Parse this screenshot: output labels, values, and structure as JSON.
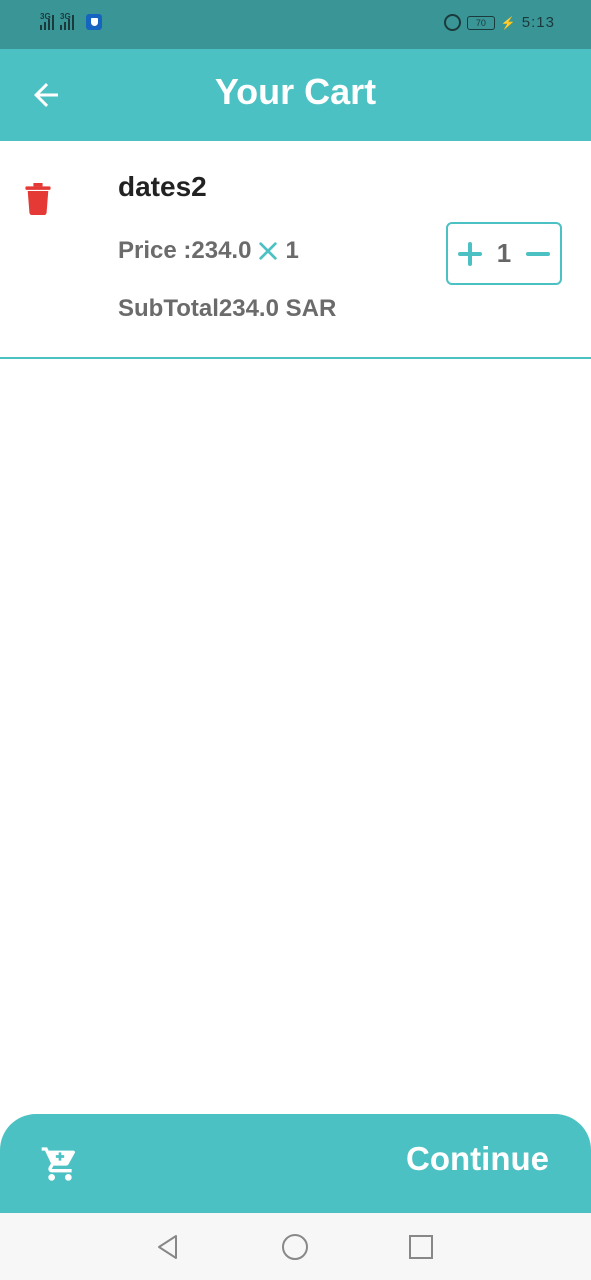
{
  "status_bar": {
    "network_1": "3G",
    "network_2": "3G",
    "battery": "70",
    "time": "5:13"
  },
  "header": {
    "title": "Your Cart",
    "back_icon": "arrow-left-icon"
  },
  "cart": {
    "items": [
      {
        "name": "dates2",
        "price_label": "Price :",
        "price": "234.0",
        "quantity_times": "1",
        "subtotal_label": "SubTotal",
        "subtotal": "234.0 SAR",
        "quantity": "1"
      }
    ]
  },
  "footer": {
    "cart_icon": "cart-icon",
    "continue_label": "Continue"
  },
  "colors": {
    "accent": "#4cc1c3",
    "status_bar": "#3a9597",
    "delete": "#e53935"
  }
}
